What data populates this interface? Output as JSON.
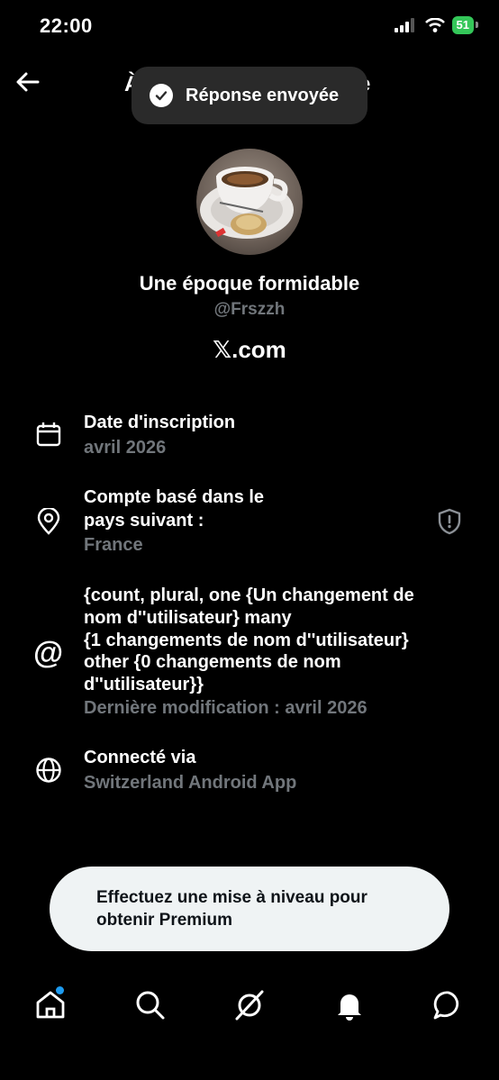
{
  "status_bar": {
    "time": "22:00",
    "battery": "51"
  },
  "header": {
    "title_left": "À",
    "title_right": "e"
  },
  "toast": {
    "text": "Réponse envoyée"
  },
  "profile": {
    "display_name": "Une époque formidable",
    "handle": "@Frszzh",
    "website": "𝕏.com"
  },
  "rows": {
    "joined": {
      "title": "Date d'inscription",
      "value": "avril 2026",
      "icon": "calendar-icon"
    },
    "country": {
      "title_line1": "Compte basé dans le",
      "title_line2": "pays suivant :",
      "value": "France",
      "icon": "location-pin-icon",
      "badge_icon": "shield-icon"
    },
    "username": {
      "line1": "{count, plural, one {Un changement de",
      "line2": "nom d''utilisateur} many",
      "line3": "{1 changements de nom d''utilisateur}",
      "line4": "other {0 changements de nom",
      "line5": "d''utilisateur}}",
      "value": "Dernière modification : avril 2026",
      "icon": "at-sign-icon"
    },
    "connected": {
      "title": "Connecté via",
      "value": "Switzerland Android App",
      "icon": "globe-icon"
    }
  },
  "premium": {
    "line1": "Effectuez une mise à niveau pour",
    "line2": "obtenir Premium"
  },
  "nav": [
    "home-icon",
    "search-icon",
    "grok-icon",
    "notifications-icon",
    "messages-icon"
  ],
  "colors": {
    "accent": "#1d9bf0",
    "muted": "#71767b",
    "toast_bg": "#2a2a2a",
    "premium_bg": "#eff3f4"
  }
}
